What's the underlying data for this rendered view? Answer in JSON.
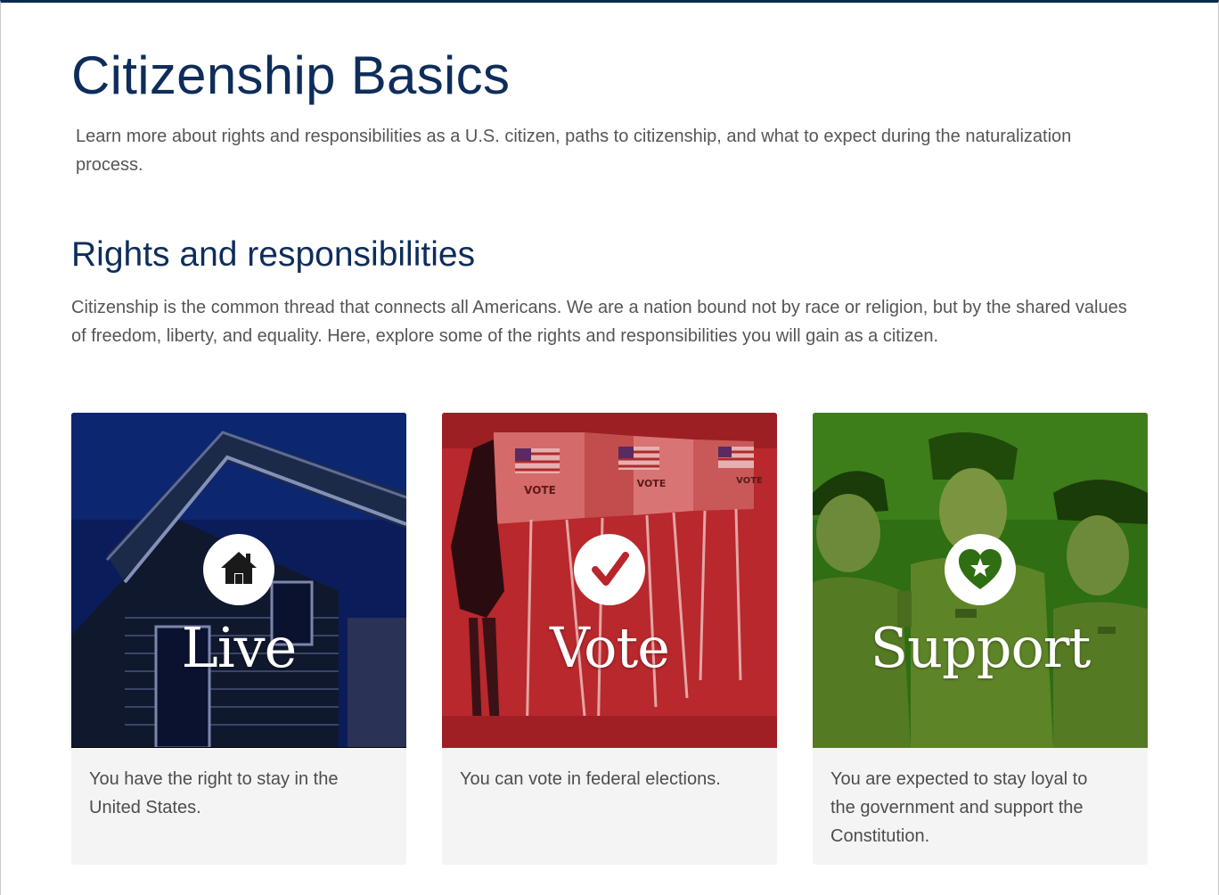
{
  "page": {
    "title": "Citizenship Basics",
    "intro": "Learn more about rights and responsibilities as a U.S. citizen, paths to citizenship, and what to expect during the naturalization process."
  },
  "section": {
    "title": "Rights and responsibilities",
    "text": "Citizenship is the common thread that connects all Americans. We are a nation bound not by race or religion, but by the shared values of freedom, liberty, and equality. Here, explore some of the rights and responsibilities you will gain as a citizen."
  },
  "cards": [
    {
      "title": "Live",
      "text": "You have the right to stay in the United States.",
      "icon": "house-icon",
      "tint": "#0b1f5c"
    },
    {
      "title": "Vote",
      "text": "You can vote in federal elections.",
      "icon": "checkmark-icon",
      "tint": "#b8262c"
    },
    {
      "title": "Support",
      "text": "You are expected to stay loyal to the government and support the Constitution.",
      "icon": "heart-star-icon",
      "tint": "#2f6e12"
    }
  ],
  "vote_booth_labels": [
    "VOTE",
    "VOTE",
    "VOTE"
  ],
  "colors": {
    "heading": "#0e2d5b",
    "body_text": "#555555",
    "card_bg": "#f4f4f4"
  }
}
